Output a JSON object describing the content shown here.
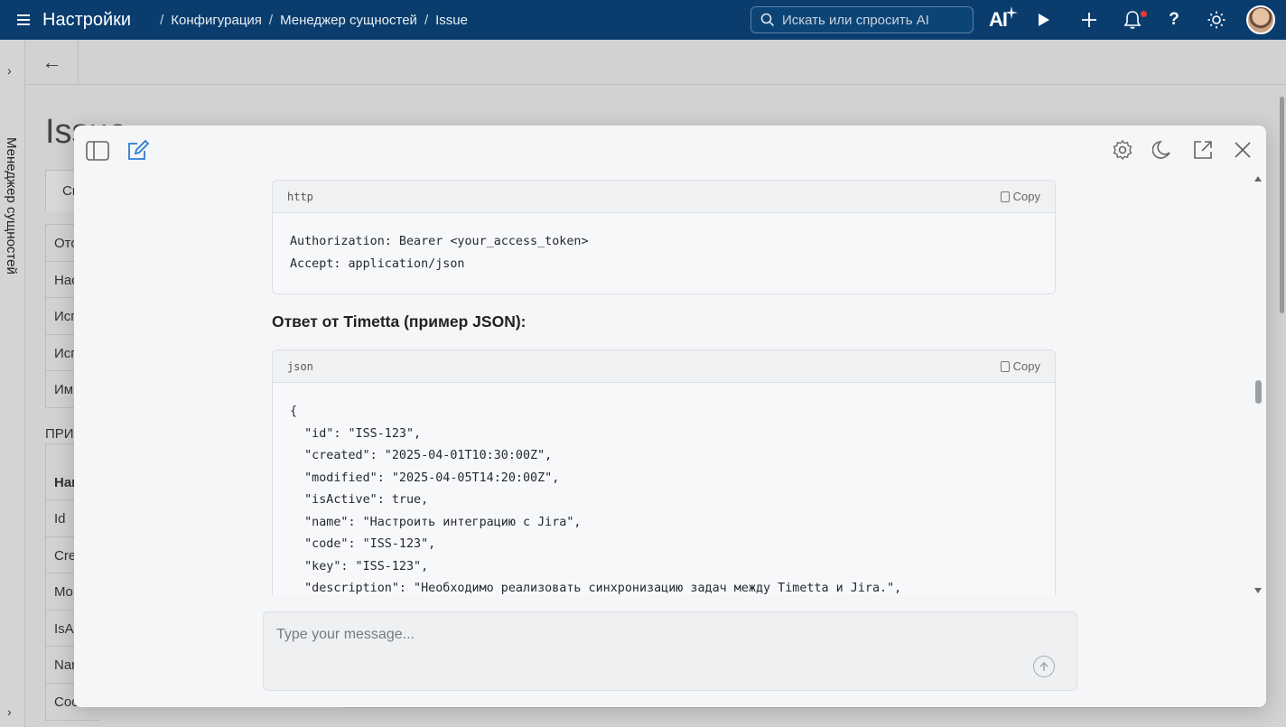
{
  "topbar": {
    "app_title": "Настройки",
    "breadcrumb": [
      "Конфигурация",
      "Менеджер сущностей",
      "Issue"
    ],
    "search_placeholder": "Искать или спросить AI",
    "ai_label": "AI"
  },
  "rail": {
    "label": "Менеджер сущностей"
  },
  "background": {
    "page_title": "Issue",
    "tab_label": "Св",
    "rows_top": [
      "Отоб",
      "Нас",
      "Исп",
      "Исп",
      "Им"
    ],
    "section_label": "ПРИ",
    "rows_bottom": [
      "Наи",
      "Id",
      "Cre",
      "Mo",
      "IsAc",
      "Nar",
      "Coc"
    ]
  },
  "modal": {
    "blocks": [
      {
        "lang": "http",
        "copy_label": "Copy",
        "code": "Authorization: Bearer <your_access_token>\nAccept: application/json"
      },
      {
        "heading": "Ответ от Timetta (пример JSON):"
      },
      {
        "lang": "json",
        "copy_label": "Copy",
        "code": "{\n  \"id\": \"ISS-123\",\n  \"created\": \"2025-04-01T10:30:00Z\",\n  \"modified\": \"2025-04-05T14:20:00Z\",\n  \"isActive\": true,\n  \"name\": \"Настроить интеграцию с Jira\",\n  \"code\": \"ISS-123\",\n  \"key\": \"ISS-123\",\n  \"description\": \"Необходимо реализовать синхронизацию задач между Timetta и Jira.\","
      }
    ],
    "composer_placeholder": "Type your message..."
  },
  "colors": {
    "topbar": "#0a3d6e",
    "modal_bg": "#f5f6f7",
    "accent_edit": "#2b7bd6"
  }
}
